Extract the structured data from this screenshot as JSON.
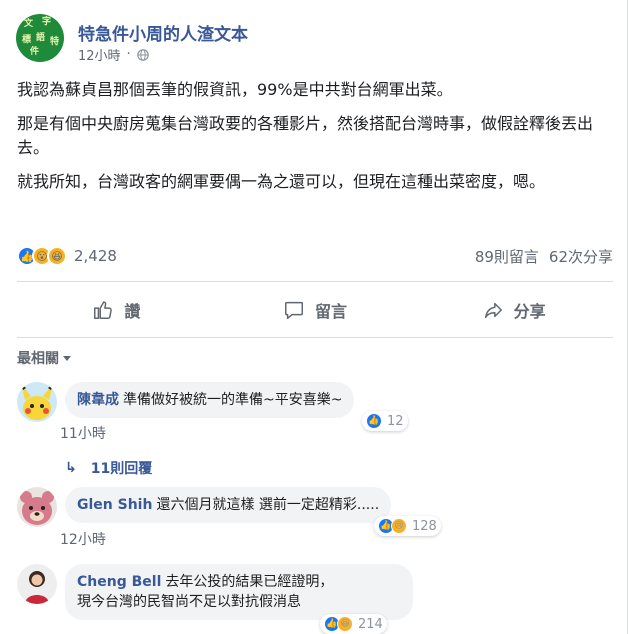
{
  "post": {
    "page_name": "特急件小周的人渣文本",
    "time": "12小時",
    "paragraphs": [
      "我認為蘇貞昌那個丟筆的假資訊，99%是中共對台網軍出菜。",
      "那是有個中央廚房蒐集台灣政要的各種影片，然後搭配台灣時事，做假詮釋後丟出去。",
      "就我所知，台灣政客的網軍要偶一為之還可以，但現在這種出菜密度，嗯。"
    ]
  },
  "stats": {
    "reaction_count": "2,428",
    "comments": "89則留言",
    "shares": "62次分享"
  },
  "actions": {
    "like": "讚",
    "comment": "留言",
    "share": "分享"
  },
  "sort_label": "最相關",
  "comments": [
    {
      "author": "陳韋成",
      "text": "準備做好被統一的準備~平安喜樂~",
      "reaction_count": "12",
      "time": "11小時",
      "replies": "11則回覆"
    },
    {
      "author": "Glen Shih",
      "text": "還六個月就這樣 選前一定超精彩.....",
      "reaction_count": "128",
      "time": "12小時"
    },
    {
      "author": "Cheng Bell",
      "text_line1": "去年公投的結果已經證明，",
      "text_line2": "現今台灣的民智尚不足以對抗假消息",
      "reaction_count": "214"
    }
  ],
  "colors": {
    "link": "#385898",
    "like_blue": "#1877f2",
    "bubble": "#f2f3f5"
  }
}
